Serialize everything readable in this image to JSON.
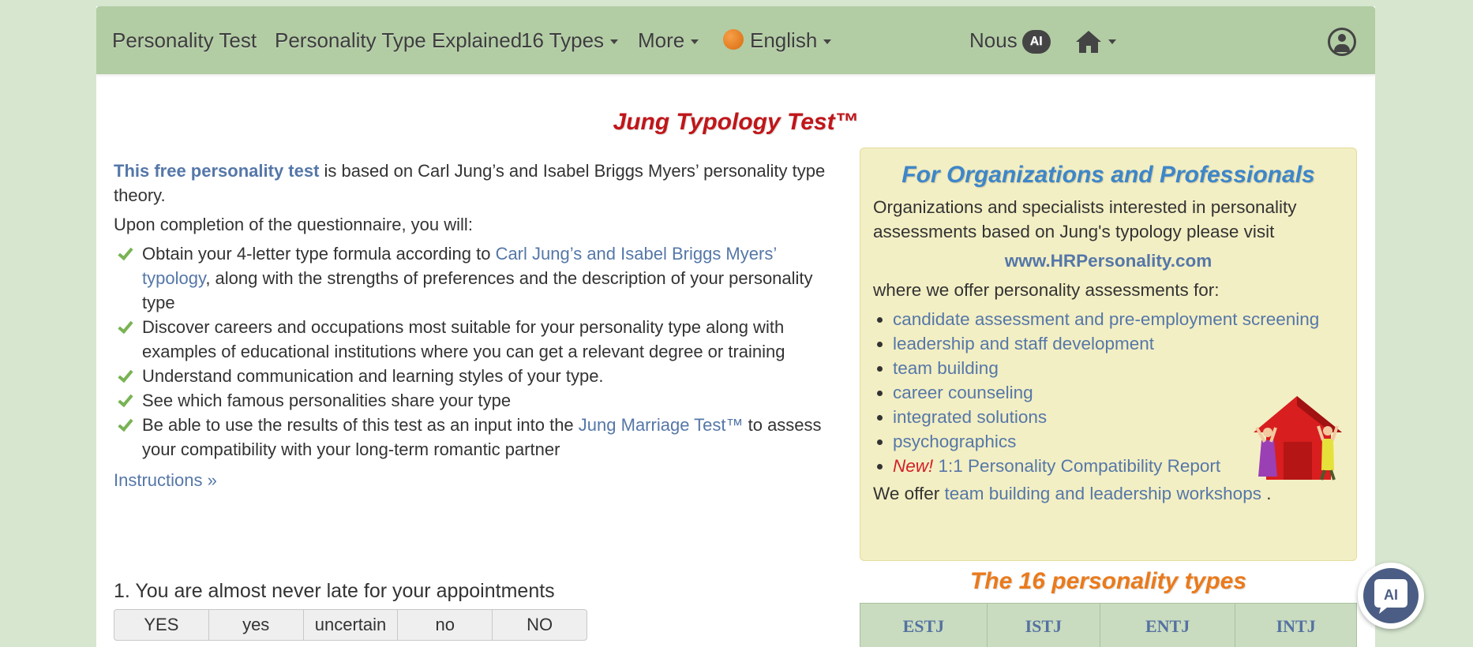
{
  "navbar": {
    "brand": "Personality Test",
    "explained": "Personality Type Explained",
    "types": "16 Types",
    "more": "More",
    "language": "English",
    "nous": "Nous",
    "nous_badge": "AI"
  },
  "title": "Jung Typology Test™",
  "intro": {
    "link": "This free personality test",
    "rest": " is based on Carl Jung’s and Isabel Briggs Myers’ personality type theory.",
    "completion": "Upon completion of the questionnaire, you will:"
  },
  "benefits": [
    {
      "pre": "Obtain your 4-letter type formula according to ",
      "link": "Carl Jung’s and Isabel Briggs Myers’ typology",
      "post": ", along with the strengths of preferences and the description of your personality type"
    },
    {
      "pre": "Discover careers and occupations most suitable for your personality type along with examples of educational institutions where you can get a relevant degree or training",
      "link": "",
      "post": ""
    },
    {
      "pre": "Understand communication and learning styles of your type.",
      "link": "",
      "post": ""
    },
    {
      "pre": "See which famous personalities share your type",
      "link": "",
      "post": ""
    },
    {
      "pre": "Be able to use the results of this test as an input into the ",
      "link": "Jung Marriage Test™",
      "post": " to assess your compatibility with your long-term romantic partner"
    }
  ],
  "instructions": "Instructions »",
  "question": {
    "text": "1. You are almost never late for your appointments",
    "answers": [
      "YES",
      "yes",
      "uncertain",
      "no",
      "NO"
    ]
  },
  "org": {
    "title": "For Organizations and Professionals",
    "text1": "Organizations and specialists interested in personality assessments based on Jung's typology please visit",
    "site": "www.HRPersonality.com",
    "text2": "where we offer personality assessments for:",
    "items": [
      "candidate assessment and pre-employment screening",
      "leadership and staff development",
      "team building",
      "career counseling",
      "integrated solutions",
      "psychographics"
    ],
    "new_tag": "New!",
    "new_item": " 1:1 Personality Compatibility Report",
    "offer_pre": "We offer ",
    "offer_link": "team building and leadership workshops",
    "offer_post": " ."
  },
  "types_section": {
    "title": "The 16 personality types",
    "row1": [
      "ESTJ",
      "ISTJ",
      "ENTJ",
      "INTJ"
    ]
  },
  "ai_fab": "AI",
  "colors": {
    "navbar": "#b2cca4",
    "title_red": "#c0161a",
    "link_blue": "#5577a8",
    "org_bg": "#f3efc4",
    "types_orange": "#ea7a1c"
  }
}
